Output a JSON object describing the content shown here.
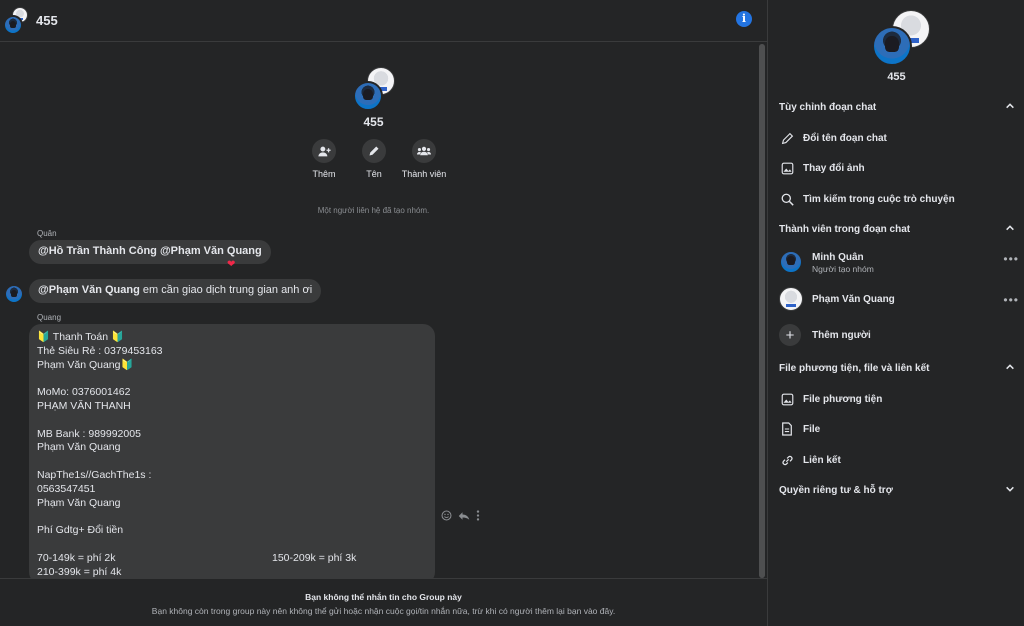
{
  "header": {
    "title": "455"
  },
  "intro": {
    "title": "455",
    "actions": [
      {
        "label": "Thêm",
        "icon": "add-person-icon"
      },
      {
        "label": "Tên",
        "icon": "pencil-icon"
      },
      {
        "label": "Thành viên",
        "icon": "members-icon"
      }
    ],
    "system_note": "Một người liên hệ đã tạo nhóm."
  },
  "messages": {
    "m1": {
      "sender": "Quân",
      "text": "@Hồ Trần Thành Công @Phạm Văn Quang",
      "reaction": "❤"
    },
    "m2": {
      "mention": "@Phạm Văn Quang",
      "text": " em cần giao dịch trung gian anh ơi"
    },
    "m3": {
      "sender": "Quang",
      "lines": [
        "🔰 Thanh Toán 🔰",
        "Thẻ Siêu Rẻ : 0379453163",
        "Phạm Văn Quang🔰",
        "",
        "MoMo: 0376001462",
        "PHẠM VĂN THANH",
        "",
        "MB Bank : 989992005",
        "Phạm Văn Quang",
        "",
        "NapThe1s//GachThe1s :",
        "0563547451",
        "Phạm Văn Quang",
        "",
        " Phí Gdtg+ Đổi tiền",
        ""
      ],
      "fees": [
        [
          "70-149k = phí 2k",
          "150-209k = phí 3k"
        ],
        [
          "210-399k = phí 4k",
          ""
        ]
      ]
    }
  },
  "footer": {
    "title": "Bạn không thể nhắn tin cho Group này",
    "text": "Bạn không còn trong group này nên không thể gửi hoặc nhận cuộc gọi/tin nhắn nữa, trừ khi có người thêm lại bạn vào đây."
  },
  "panel": {
    "title": "455",
    "customize": {
      "heading": "Tùy chỉnh đoạn chat",
      "items": [
        "Đổi tên đoạn chat",
        "Thay đổi ảnh",
        "Tìm kiếm trong cuộc trò chuyện"
      ]
    },
    "members": {
      "heading": "Thành viên trong đoạn chat",
      "list": [
        {
          "name": "Minh Quân",
          "subtitle": "Người tạo nhóm"
        },
        {
          "name": "Phạm Văn Quang",
          "subtitle": ""
        }
      ],
      "add_label": "Thêm người"
    },
    "media": {
      "heading": "File phương tiện, file và liên kết",
      "items": [
        "File phương tiện",
        "File",
        "Liên kết"
      ]
    },
    "privacy": {
      "heading": "Quyền riêng tư & hỗ trợ"
    }
  },
  "colors": {
    "background": "#242526",
    "bubble": "#3a3b3c",
    "accent": "#2374e1",
    "heart": "#f02849"
  }
}
